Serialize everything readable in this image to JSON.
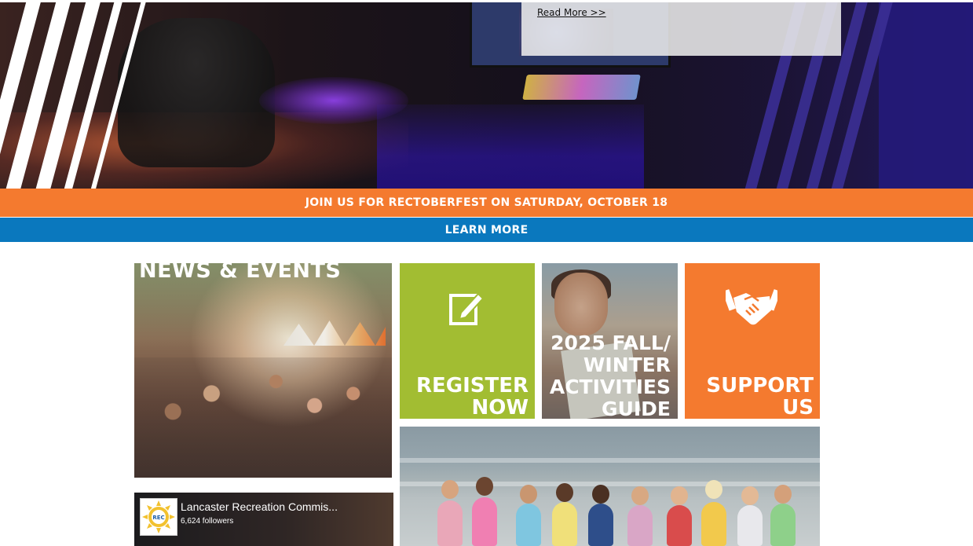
{
  "hero": {
    "read_more": "Read More >>"
  },
  "banners": {
    "rectoberfest": "JOIN US FOR RECTOBERFEST ON SATURDAY, OCTOBER 18",
    "learn_more": "LEARN MORE"
  },
  "tiles": {
    "news": {
      "title": "NEWS & EVENTS"
    },
    "register": {
      "line1": "REGISTER",
      "line2": "NOW",
      "icon": "edit-icon"
    },
    "guide": {
      "line1": "2025 FALL/",
      "line2": "WINTER",
      "line3": "ACTIVITIES",
      "line4": "GUIDE"
    },
    "support": {
      "line1": "SUPPORT",
      "line2": "US",
      "icon": "handshake-icon"
    }
  },
  "facebook": {
    "page_name": "Lancaster Recreation Commis...",
    "followers": "6,624 followers",
    "logo_text": "REC"
  },
  "colors": {
    "orange": "#f47a2f",
    "blue": "#0a78be",
    "green": "#a2bd32"
  }
}
